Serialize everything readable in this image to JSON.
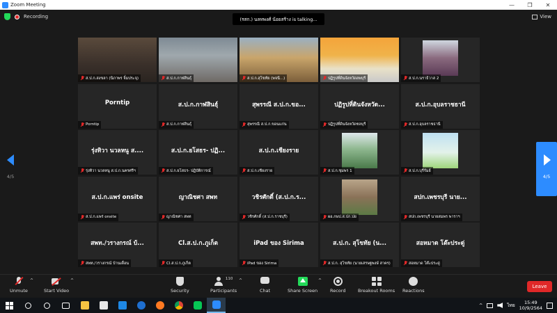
{
  "window": {
    "title": "Zoom Meeting",
    "controls": [
      "—",
      "❐",
      "✕"
    ]
  },
  "meeting": {
    "recording_label": "Recording",
    "talking_banner": "(รสก.) นลทพงศ์ น้อยสร้าง is  talking...",
    "view_label": "View",
    "page_left": "4/5",
    "page_right": "4/5"
  },
  "participants": [
    {
      "big": "",
      "label": "ส.ป.ก.สงขลา (นิภาพร  จิ๋มประจุ)",
      "video": "face-dim",
      "muted": true
    },
    {
      "big": "",
      "label": "ส.ป.ก.กาฬสินธุ์",
      "video": "room-masked",
      "muted": true
    },
    {
      "big": "",
      "label": "ส.ป.ก.สุโขทัย (พจนี...)",
      "video": "sukhothai-bg",
      "muted": true
    },
    {
      "big": "",
      "label": "ปฏิรูปที่ดินจังหวัดลพบุรี",
      "video": "orange-banner",
      "muted": true
    },
    {
      "big": "",
      "label": "ส.ป.ก.นราธิวาส 2",
      "video": "portrait-thumb",
      "muted": true
    },
    {
      "big": "Porntip",
      "label": "Porntip",
      "video": "",
      "muted": true
    },
    {
      "big": "ส.ป.ก.กาฬสินธุ์",
      "label": "ส.ป.ก.กาฬสินธุ์",
      "video": "",
      "muted": true
    },
    {
      "big": "สุพรรณี ส.ป.ก.ขอ...",
      "label": "สุพรรณี ส.ป.ก.ขอนแก่น",
      "video": "",
      "muted": true
    },
    {
      "big": "ปฏิรูปที่ดินจังหวัด...",
      "label": "ปฏิรูปที่ดินจังหวัดชลบุรี",
      "video": "",
      "muted": true
    },
    {
      "big": "ส.ป.ก.อุบลราชธานี",
      "label": "ส.ป.ก.อุบลราชธานี",
      "video": "",
      "muted": true
    },
    {
      "big": "รุ่งทิวา นวลหนู ส....",
      "label": "รุ่งทิวา นวลหนู ส.ป.ก.นครศรีฯ",
      "video": "",
      "muted": true
    },
    {
      "big": "ส.ป.ก.ยโสธร- ปฏิ...",
      "label": "ส.ป.ก.ยโสธร- ปฏิบัติการณ์",
      "video": "",
      "muted": true
    },
    {
      "big": "ส.ป.ก.เชียงราย",
      "label": "ส.ป.ก.เชียงราย",
      "video": "",
      "muted": true
    },
    {
      "big": "",
      "label": "ส.ป.ก.ชุมพร 1",
      "video": "landscape-thumb",
      "muted": true
    },
    {
      "big": "",
      "label": "ส.ป.ก.บุรีรัมย์",
      "video": "sky-thumb",
      "muted": true
    },
    {
      "big": "ส.ป.ก.แพร่ onsite",
      "label": "ส.ป.ก.แพร่ onsite",
      "video": "",
      "muted": true
    },
    {
      "big": "ญาณิชศา สพท",
      "label": "ญาณิชศา สพท",
      "video": "",
      "muted": true
    },
    {
      "big": "วชิรศักดิ์ (ส.ป.ก.ร...",
      "label": "วชิรศักดิ์ (ส.ป.ก.ราชบุรี)",
      "video": "",
      "muted": true
    },
    {
      "big": "",
      "label": "ผอ.กษป.ส.ปก.ปย",
      "video": "selfie-thumb",
      "muted": true
    },
    {
      "big": "สปก.เพชรบุรี นาย...",
      "label": "สปก.เพชรบุรี นายสมพร พาราฯ",
      "video": "",
      "muted": true
    },
    {
      "big": "สพท./วรางกรณ์ บ้...",
      "label": "สพท./วรางกรณ์ บ้านเดื่อน",
      "video": "",
      "muted": true
    },
    {
      "big": "Cl.ส.ป.ก.ภูเก็ต",
      "label": "Cl.ส.ป.ก.ภูเก็ต",
      "video": "",
      "muted": true
    },
    {
      "big": "iPad ของ Sirima",
      "label": "iPad ของ Sirima",
      "video": "",
      "muted": true
    },
    {
      "big": "ส.ป.ก. สุโขทัย (น...",
      "label": "ส.ป.ก. สุโขทัย (นายเสรษฐพงษ์ สาคร)",
      "video": "",
      "muted": true
    },
    {
      "big": "สอหมาด โต๊ะประดู่",
      "label": "สอหมาด โต๊ะประดู่",
      "video": "",
      "muted": true
    }
  ],
  "toolbar": {
    "unmute": "Unmute",
    "start_video": "Start Video",
    "security": "Security",
    "participants": "Participants",
    "participants_count": "110",
    "chat": "Chat",
    "share_screen": "Share Screen",
    "record": "Record",
    "breakout": "Breakout Rooms",
    "reactions": "Reactions",
    "leave": "Leave",
    "caret": "^"
  },
  "taskbar": {
    "lang": "ไทย",
    "time": "15:49",
    "date": "10/9/2564",
    "tray_chevron": "^"
  },
  "colors": {
    "zoom_blue": "#2d8cff",
    "leave_red": "#e02828",
    "share_green": "#23d959",
    "tile_bg": "#262626"
  }
}
